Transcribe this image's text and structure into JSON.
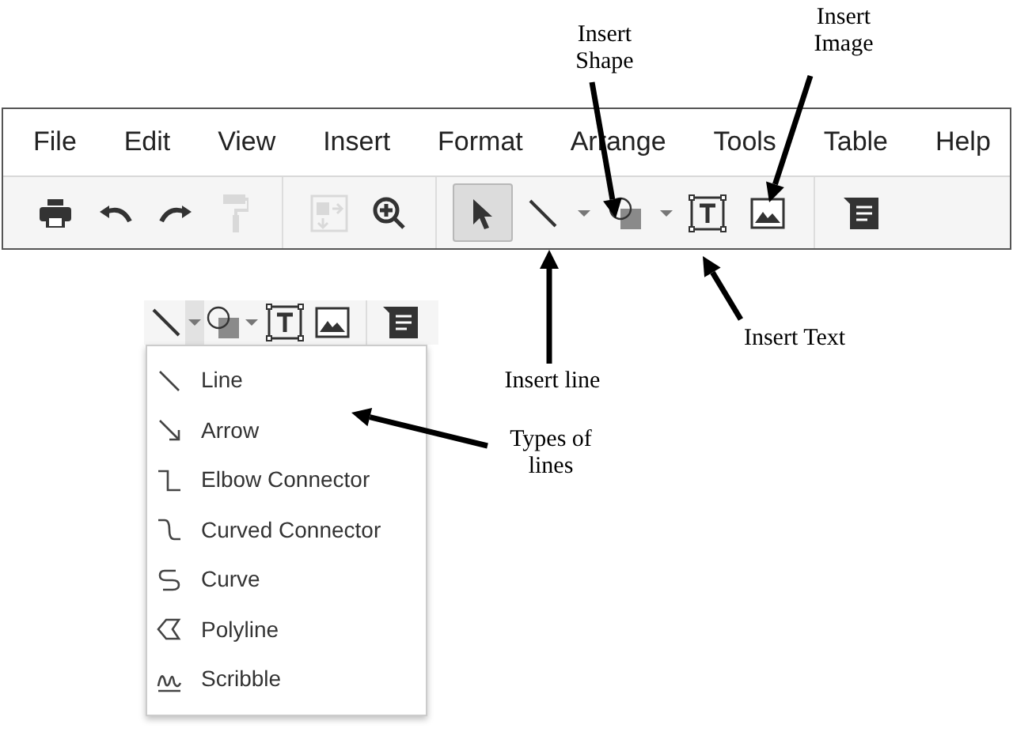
{
  "menu_bar": {
    "items": [
      "File",
      "Edit",
      "View",
      "Insert",
      "Format",
      "Arrange",
      "Tools",
      "Table",
      "Help"
    ]
  },
  "toolbar": {
    "tools": [
      {
        "kind": "print",
        "selected": false,
        "disabled": false
      },
      {
        "kind": "undo",
        "selected": false,
        "disabled": false
      },
      {
        "kind": "redo",
        "selected": false,
        "disabled": false
      },
      {
        "kind": "paint",
        "selected": false,
        "disabled": true
      },
      {
        "kind": "sep"
      },
      {
        "kind": "arrange",
        "selected": false,
        "disabled": true
      },
      {
        "kind": "zoom",
        "selected": false,
        "disabled": false
      },
      {
        "kind": "sep"
      },
      {
        "kind": "select",
        "selected": true,
        "disabled": false
      },
      {
        "kind": "line",
        "selected": false,
        "disabled": false
      },
      {
        "kind": "caret"
      },
      {
        "kind": "shape",
        "selected": false,
        "disabled": false
      },
      {
        "kind": "caret"
      },
      {
        "kind": "text",
        "selected": false,
        "disabled": false
      },
      {
        "kind": "image",
        "selected": false,
        "disabled": false
      },
      {
        "kind": "sep"
      },
      {
        "kind": "comment",
        "selected": false,
        "disabled": false
      }
    ]
  },
  "line_menu": {
    "items": [
      {
        "label": "Line",
        "kind": "line"
      },
      {
        "label": "Arrow",
        "kind": "arrow"
      },
      {
        "label": "Elbow Connector",
        "kind": "elbow"
      },
      {
        "label": "Curved Connector",
        "kind": "curved"
      },
      {
        "label": "Curve",
        "kind": "curve"
      },
      {
        "label": "Polyline",
        "kind": "polyline"
      },
      {
        "label": "Scribble",
        "kind": "scribble"
      }
    ]
  },
  "annotations": [
    "Insert Shape",
    "Insert Image",
    "Insert line",
    "Insert Text",
    "Types of lines"
  ]
}
